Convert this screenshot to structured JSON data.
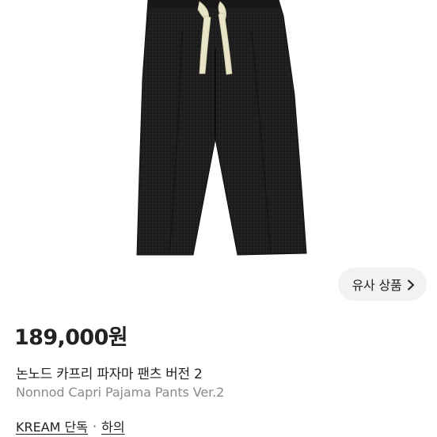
{
  "product": {
    "image_alt": "black pajama pants with beige drawstring",
    "similar_button_label": "유사 상품",
    "price": "189,000원",
    "name_ko": "논노드 카프리 파자마 팬츠 버전 2",
    "name_en": "Nonnod Capri Pajama Pants Ver.2",
    "tags": {
      "exclusive": "KREAM 단독",
      "separator": "·",
      "category": "하의"
    }
  },
  "icons": {
    "similar_chevron": "chevron-right-icon"
  },
  "colors": {
    "pants": "#1c1c1c",
    "drawstring": "#e8e4c8",
    "button_bg": "#f2f2f2",
    "secondary_text": "#8a8a8a"
  }
}
